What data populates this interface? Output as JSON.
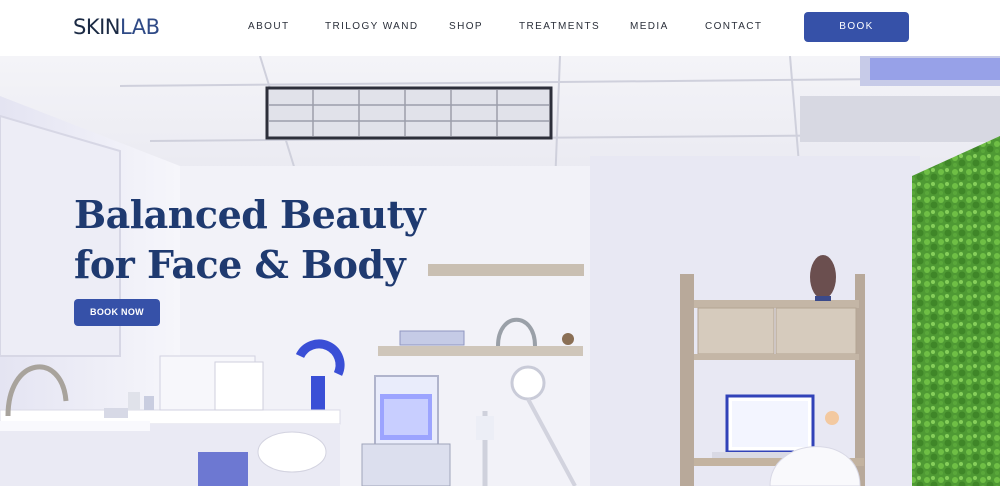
{
  "brand": {
    "logo_part1": "SKIN",
    "logo_part2": "LAB"
  },
  "nav": {
    "items": [
      {
        "label": "ABOUT"
      },
      {
        "label": "TRILOGY WAND"
      },
      {
        "label": "SHOP"
      },
      {
        "label": "TREATMENTS"
      },
      {
        "label": "MEDIA"
      },
      {
        "label": "CONTACT"
      }
    ],
    "book_label": "BOOK"
  },
  "hero": {
    "title_line1": "Balanced Beauty",
    "title_line2": "for Face & Body",
    "cta_label": "BOOK NOW",
    "image_description_icon": "treatment-room-photo"
  },
  "colors": {
    "accent": "#3651a8",
    "heading": "#1f3a70",
    "logo": "#1b2a44"
  }
}
